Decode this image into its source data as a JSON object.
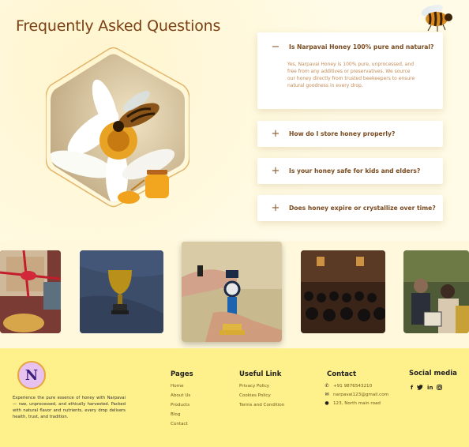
{
  "faq": {
    "title": "Frequently Asked Questions",
    "items": [
      {
        "question": "Is Narpavai Honey 100% pure and natural?",
        "answer": "Yes, Narpavai Honey is 100% pure, unprocessed, and free from any additives or preservatives. We source our honey directly from trusted beekeepers to ensure natural goodness in every drop.",
        "expanded_sign": "−"
      },
      {
        "question": "How do I store honey properly?",
        "sign": "+"
      },
      {
        "question": "Is your honey safe for kids and elders?",
        "sign": "+"
      },
      {
        "question": "Does honey expire or crystallize over time?",
        "sign": "+"
      }
    ]
  },
  "gallery": {
    "items": [
      "gift-box-photo",
      "trophy-on-blanket-photo",
      "trophy-handover-photo",
      "auditorium-audience-photo",
      "award-ceremony-photo"
    ]
  },
  "footer": {
    "logo_text": "N",
    "description": "Experience the pure essence of honey with Narpavai — raw, unprocessed, and ethically harvested. Packed with natural flavor and nutrients, every drop delivers health, trust, and tradition.",
    "pages": {
      "title": "Pages",
      "links": [
        "Home",
        "About Us",
        "Products",
        "Blog",
        "Contact"
      ]
    },
    "useful": {
      "title": "Useful Link",
      "links": [
        "Privacy Policy",
        "Cookies Policy",
        "Terms and Condition"
      ]
    },
    "contact": {
      "title": "Contact",
      "phone": "+91 9876543210",
      "email": "narpavai123@gmail.com",
      "address": "123, North main road"
    },
    "social": {
      "title": "Social media",
      "icons": [
        "facebook-icon",
        "twitter-icon",
        "linkedin-icon",
        "instagram-icon"
      ]
    }
  },
  "colors": {
    "accent": "#7a3f12",
    "footer_bg": "#fef08a",
    "page_bg": "#fffbe6"
  }
}
